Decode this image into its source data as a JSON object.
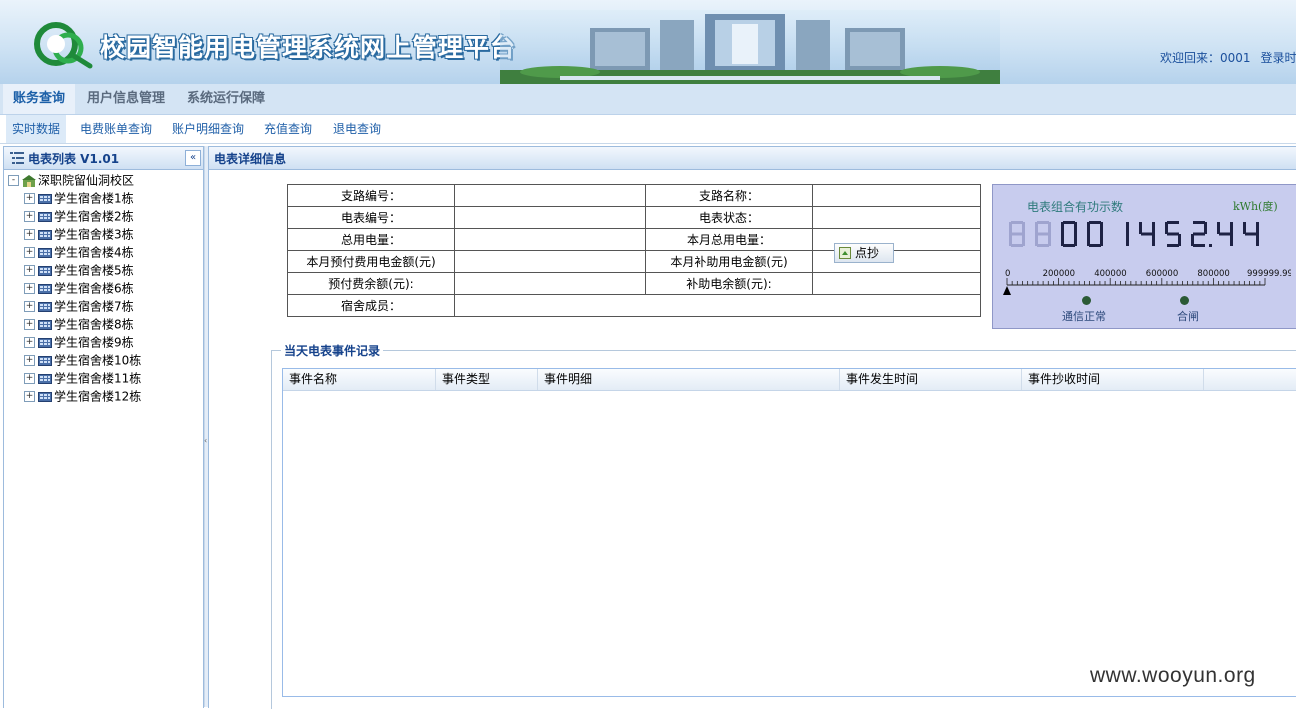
{
  "header": {
    "title": "校园智能用电管理系统网上管理平台",
    "welcome_text": "欢迎回来：0001",
    "login_time_label": "登录时"
  },
  "nav_main": [
    "账务查询",
    "用户信息管理",
    "系统运行保障"
  ],
  "nav_sub": [
    "实时数据",
    "电费账单查询",
    "账户明细查询",
    "充值查询",
    "退电查询"
  ],
  "left_panel": {
    "title": "电表列表 V1.01",
    "collapse_glyph": "«",
    "root": "深职院留仙洞校区",
    "buildings": [
      "学生宿舍楼1栋",
      "学生宿舍楼2栋",
      "学生宿舍楼3栋",
      "学生宿舍楼4栋",
      "学生宿舍楼5栋",
      "学生宿舍楼6栋",
      "学生宿舍楼7栋",
      "学生宿舍楼8栋",
      "学生宿舍楼9栋",
      "学生宿舍楼10栋",
      "学生宿舍楼11栋",
      "学生宿舍楼12栋"
    ]
  },
  "detail": {
    "title": "电表详细信息",
    "labels": {
      "branch_no": "支路编号：",
      "branch_name": "支路名称：",
      "meter_no": "电表编号：",
      "meter_status": "电表状态：",
      "total_usage": "总用电量：",
      "month_total_usage": "本月总用电量：",
      "month_prepaid_amount": "本月预付费用电金额(元)",
      "month_subsidy_amount": "本月补助用电金额(元)",
      "prepaid_balance": "预付费余额(元):",
      "subsidy_balance": "补助电余额(元):",
      "dorm_members": "宿舍成员："
    },
    "refresh_button": "点抄"
  },
  "meter": {
    "title": "电表组合有功示数",
    "unit": "kWh(度)",
    "reading": "001452.44",
    "scale_ticks": [
      "0",
      "200000",
      "400000",
      "600000",
      "800000",
      "999999.99"
    ],
    "indicator_comm": "通信正常",
    "indicator_switch": "合闸",
    "digit_color": "#1e2244",
    "ghost_color": "#9fa4cf"
  },
  "events": {
    "legend": "当天电表事件记录",
    "columns": [
      "事件名称",
      "事件类型",
      "事件明细",
      "事件发生时间",
      "事件抄收时间"
    ],
    "rows": []
  },
  "watermark": "www.wooyun.org"
}
